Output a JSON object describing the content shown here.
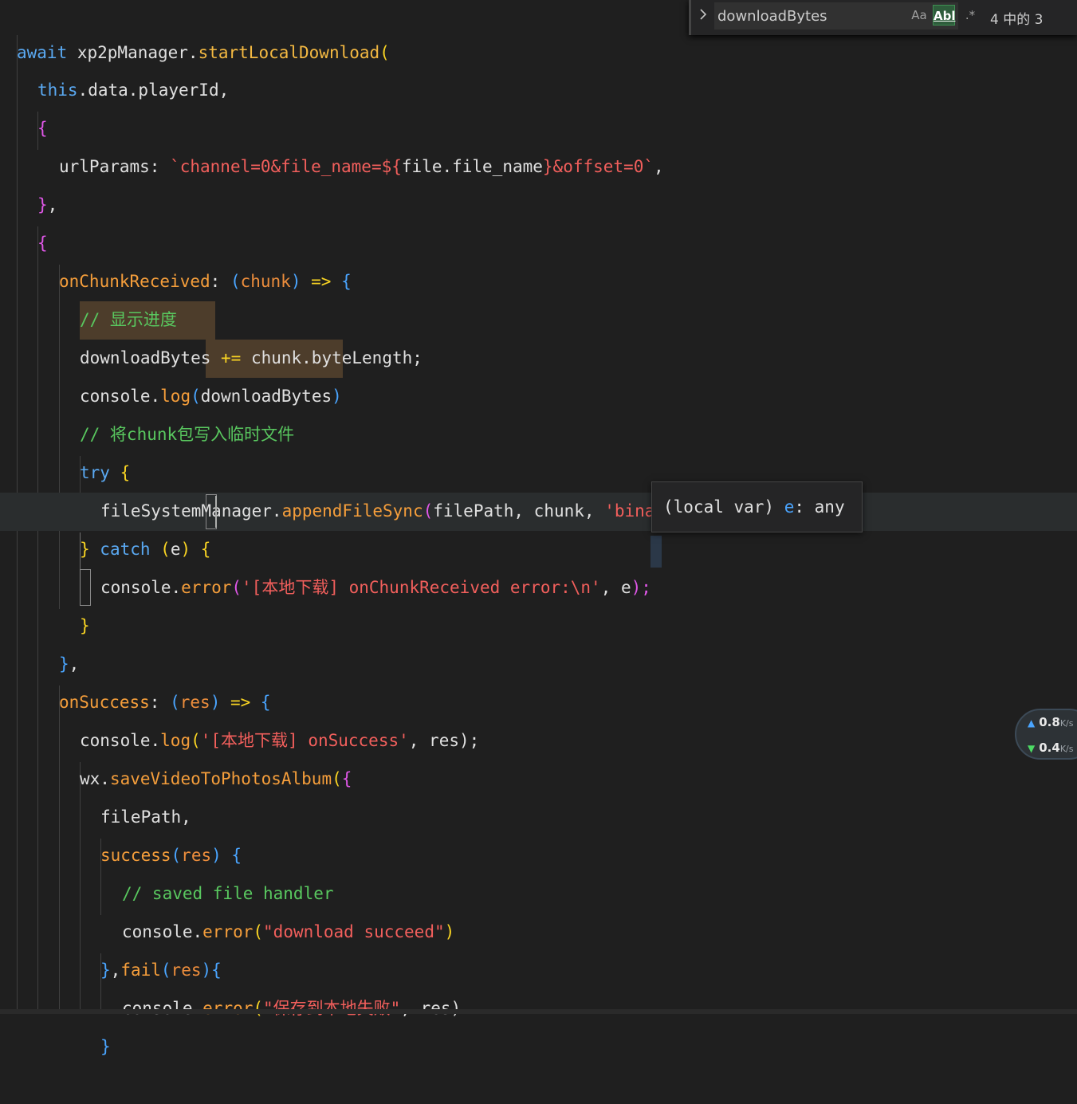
{
  "find": {
    "query": "downloadBytes",
    "match_case_label": "Aa",
    "whole_word_label": "Abl",
    "regex_label": ".*",
    "match_count": "4 中的 3"
  },
  "hover": {
    "prefix": "(local var) ",
    "name": "e",
    "suffix": ": any"
  },
  "network": {
    "up_value": "0.8",
    "up_unit": "K/s",
    "down_value": "0.4",
    "down_unit": "K/s"
  },
  "code": {
    "l1": {
      "a": "await",
      "b": " xp2pManager.",
      "c": "startLocalDownload",
      "d": "("
    },
    "l2": {
      "a": "this",
      "b": ".data.playerId,",
      "c": ""
    },
    "l3": {
      "a": "{"
    },
    "l4": {
      "a": "urlParams",
      "b": ": ",
      "c": "`channel=0&file_name=${",
      "d": "file.file_name",
      "e": "}&offset=0`",
      "f": ","
    },
    "l5": {
      "a": "}",
      "b": ","
    },
    "l6": {
      "a": "{"
    },
    "l7": {
      "a": "onChunkReceived",
      "b": ": ",
      "c": "(",
      "d": "chunk",
      "e": ")",
      "f": " => ",
      "g": "{"
    },
    "l8": {
      "a": "// 显示进度"
    },
    "l9": {
      "a": "downloadBytes",
      "b": " += ",
      "c": "chunk.byteLength;"
    },
    "l10": {
      "a": "console.",
      "b": "log",
      "c": "(",
      "d": "downloadBytes",
      "e": ")"
    },
    "l11": {
      "a": "// 将chunk包写入临时文件"
    },
    "l12": {
      "a": "try",
      "b": " {"
    },
    "l13": {
      "a": "fileSystemManager.",
      "b": "appendFileSync",
      "c": "(",
      "d": "filePath, chunk, ",
      "e": "'binary'",
      "f": ");"
    },
    "l14": {
      "a": "}",
      "b": " catch",
      "c": " (",
      "d": "e",
      "e": ") ",
      "f": "{"
    },
    "l15": {
      "a": "console.",
      "b": "error",
      "c": "(",
      "d": "'[本地下载] onChunkReceived error:\\n'",
      "e": ", ",
      "f": "e",
      "g": ");"
    },
    "l16": {
      "a": "}"
    },
    "l17": {
      "a": "}",
      "b": ","
    },
    "l18": {
      "a": "onSuccess",
      "b": ": ",
      "c": "(",
      "d": "res",
      "e": ")",
      "f": " => ",
      "g": "{"
    },
    "l19": {
      "a": "console.",
      "b": "log",
      "c": "(",
      "d": "'[本地下载] onSuccess'",
      "e": ", res);"
    },
    "l20": {
      "a": "wx.",
      "b": "saveVideoToPhotosAlbum",
      "c": "(",
      "d": "{"
    },
    "l21": {
      "a": "filePath,"
    },
    "l22": {
      "a": "success",
      "b": "(",
      "c": "res",
      "d": ")",
      "e": " {"
    },
    "l23": {
      "a": "// saved file handler"
    },
    "l24": {
      "a": "console.",
      "b": "error",
      "c": "(",
      "d": "\"download succeed\"",
      "e": ")"
    },
    "l25": {
      "a": "}",
      "b": ",",
      "c": "fail",
      "d": "(",
      "e": "res",
      "f": "){"
    },
    "l26": {
      "a": "console.",
      "b": "error",
      "c": "(",
      "d": "\"保存到本地失败\"",
      "e": ", res)"
    },
    "l27": {
      "a": "}"
    }
  }
}
